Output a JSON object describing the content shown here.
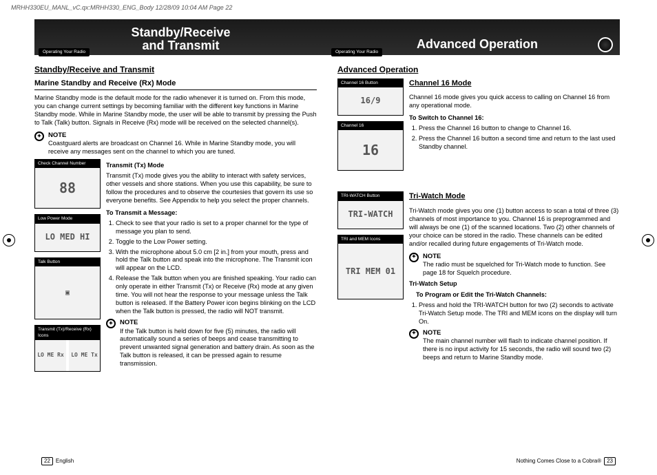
{
  "printMark": "MRHH330EU_MANL_vC.qx:MRHH330_ENG_Body  12/28/09  10:04 AM  Page 22",
  "header": {
    "leftTitle": "Standby/Receive\nand Transmit",
    "rightTitle": "Advanced Operation",
    "tagLeft": "Operating Your Radio",
    "tagRight": "Operating Your Radio"
  },
  "left": {
    "secTitle": "Standby/Receive and Transmit",
    "subTitle": "Marine Standby and Receive (Rx) Mode",
    "marinePara": "Marine Standby mode is the default mode for the radio whenever it is turned on. From this mode, you can change current settings by becoming familiar with the different key functions in Marine Standby mode. While in Marine Standby mode, the user will be able to transmit by pressing the Push to Talk (Talk) button. Signals in Receive (Rx) mode will be received on the selected channel(s).",
    "note1Label": "NOTE",
    "note1Body": "Coastguard alerts are broadcast on Channel 16. While in Marine Standby mode, you will receive any messages sent on the channel to which you are tuned.",
    "txTitle": "Transmit (Tx) Mode",
    "txPara": "Transmit (Tx) mode gives you the ability to interact with safety services, other vessels and shore stations. When you use this capability, be sure to follow the procedures and to observe the courtesies that govern its use so everyone benefits. See Appendix to help you select the proper channels.",
    "txStepsTitle": "To Transmit a Message:",
    "txSteps": [
      "Check to see that your radio is set to a proper channel for the type of message you plan to send.",
      "Toggle to the Low Power setting.",
      "With the microphone about 5.0 cm [2 in.] from your mouth, press and hold the Talk button and speak into the microphone. The Transmit icon will appear on the LCD.",
      "Release the Talk button when you are finished speaking. Your radio can only operate in either Transmit (Tx) or Receive (Rx) mode at any given time. You will not hear the response to your message unless the Talk button is released. If the Battery Power icon begins blinking on the LCD when the Talk button is pressed, the radio will NOT transmit."
    ],
    "note2Label": "NOTE",
    "note2Body": "If the Talk button is held down for five (5) minutes, the radio will automatically sound a series of beeps and cease transmitting to prevent unwanted signal generation and battery drain. As soon as the Talk button is released, it can be pressed again to resume transmission.",
    "thumbs": {
      "checkCh": {
        "label": "Check Channel Number",
        "body": "88"
      },
      "lowPwr": {
        "label": "Low Power Mode",
        "body": "LO MED HI"
      },
      "talk": {
        "label": "Talk Button",
        "body": "▣"
      },
      "txrx": {
        "label": "Transmit (Tx)/Receive (Rx) Icons",
        "bodyA": "LO ME Rx",
        "bodyB": "LO ME Tx"
      }
    }
  },
  "right": {
    "secTitle": "Advanced Operation",
    "ch16Title": "Channel 16 Mode",
    "ch16Para": "Channel 16 mode gives you quick access to calling on Channel 16 from any operational mode.",
    "ch16StepsTitle": "To Switch to Channel 16:",
    "ch16Steps": [
      "Press the Channel 16 button to change to Channel 16.",
      "Press the Channel 16 button a second time and return to the last used Standby channel."
    ],
    "thumbs16": {
      "btn": {
        "label": "Channel 16 Button",
        "body": "16/9"
      },
      "disp": {
        "label": "Channel 16",
        "body": "16"
      }
    },
    "triTitle": "Tri-Watch Mode",
    "triPara": "Tri-Watch mode gives you one (1) button access to scan a total of three (3) channels of most importance to you. Channel 16 is preprogrammed and will always be one (1) of the scanned locations. Two (2) other channels of your choice can be stored in the radio. These channels can be edited and/or recalled during future engagements of Tri-Watch mode.",
    "triNote1Label": "NOTE",
    "triNote1Body": "The radio must be squelched for Tri-Watch mode to function. See page 18 for Squelch procedure.",
    "triSetupHead": "Tri-Watch Setup",
    "triStepsTitle": "To Program or Edit the Tri-Watch Channels:",
    "triSteps": [
      "Press and hold the TRI-WATCH button for two (2) seconds to activate Tri-Watch Setup mode. The TRI and MEM icons on the display will turn On."
    ],
    "triNote2Label": "NOTE",
    "triNote2Body": "The main channel number will flash to indicate channel position. If there is no input activity for 15 seconds, the radio will sound two (2) beeps and return to Marine Standby mode.",
    "thumbsTri": {
      "btn": {
        "label": "TRI-WATCH Button",
        "body": "TRI-WATCH"
      },
      "icons": {
        "label": "TRI and MEM Icons",
        "body": "TRI MEM 01"
      }
    }
  },
  "footer": {
    "pageLeft": "22",
    "langLeft": "English",
    "taglineRight": "Nothing Comes Close to a Cobra®",
    "pageRight": "23"
  }
}
